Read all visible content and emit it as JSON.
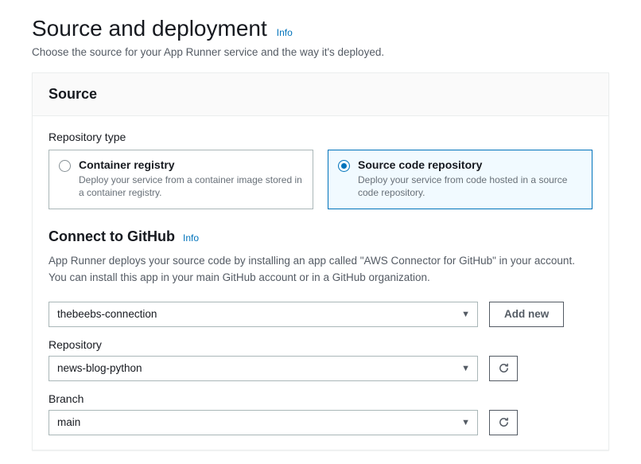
{
  "header": {
    "title": "Source and deployment",
    "info": "Info",
    "subtitle": "Choose the source for your App Runner service and the way it's deployed."
  },
  "panel": {
    "title": "Source",
    "repoTypeLabel": "Repository type",
    "options": {
      "container": {
        "title": "Container registry",
        "desc": "Deploy your service from a container image stored in a container registry."
      },
      "source": {
        "title": "Source code repository",
        "desc": "Deploy your service from code hosted in a source code repository."
      }
    },
    "github": {
      "title": "Connect to GitHub",
      "info": "Info",
      "desc": "App Runner deploys your source code by installing an app called \"AWS Connector for GitHub\" in your account. You can install this app in your main GitHub account or in a GitHub organization.",
      "connection": "thebeebs-connection",
      "addNew": "Add new",
      "repoLabel": "Repository",
      "repoValue": "news-blog-python",
      "branchLabel": "Branch",
      "branchValue": "main"
    }
  }
}
